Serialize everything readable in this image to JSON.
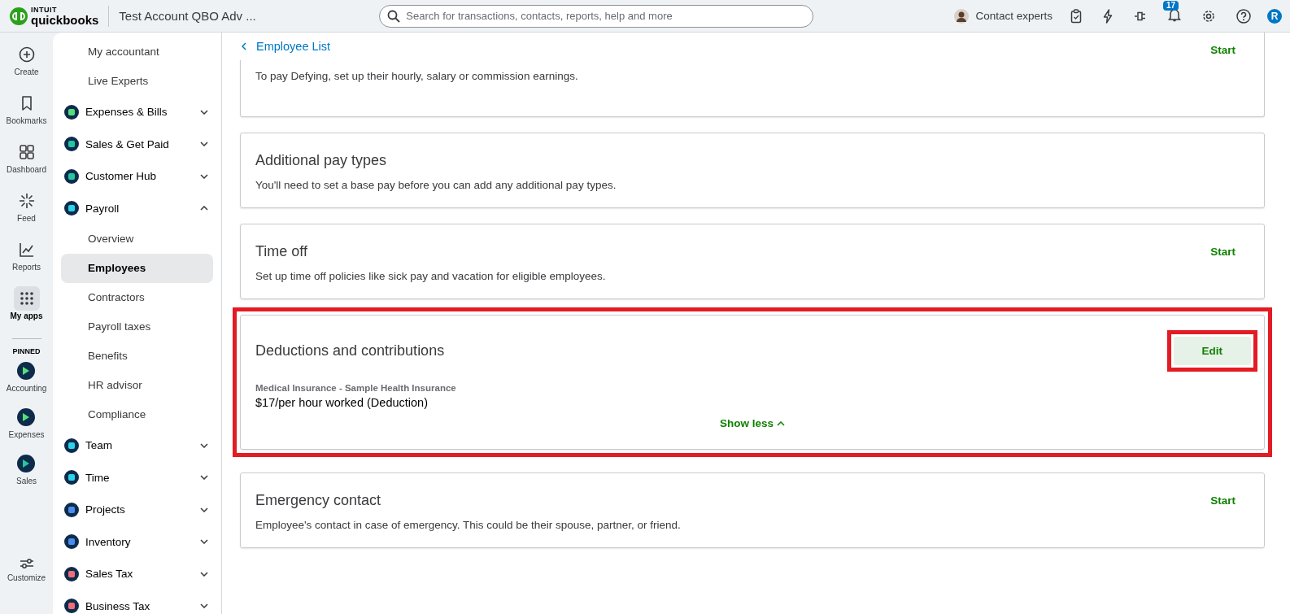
{
  "topbar": {
    "logo_brand": "INTUIT",
    "logo_product": "quickbooks",
    "company": "Test Account QBO Adv ...",
    "search": {
      "placeholder": "Search for transactions, contacts, reports, help and more"
    },
    "contact": "Contact experts",
    "notifications_badge": "17",
    "user_initial": "R"
  },
  "rail": {
    "items": [
      {
        "kind": "create",
        "label": "Create",
        "selected": false
      },
      {
        "kind": "bookmark",
        "label": "Bookmarks",
        "selected": false
      },
      {
        "kind": "dashboard",
        "label": "Dashboard",
        "selected": false
      },
      {
        "kind": "feed",
        "label": "Feed",
        "selected": false
      },
      {
        "kind": "reports",
        "label": "Reports",
        "selected": false
      },
      {
        "kind": "apps",
        "label": "My apps",
        "selected": true
      }
    ],
    "pinned_label": "PINNED",
    "pinned": [
      {
        "label": "Accounting",
        "color": "#53e07a"
      },
      {
        "label": "Expenses",
        "color": "#53e07a"
      },
      {
        "label": "Sales",
        "color": "#21c8a0"
      }
    ],
    "customize": "Customize"
  },
  "nav": {
    "items": [
      {
        "label": "My accountant",
        "kind": "link"
      },
      {
        "label": "Live Experts",
        "kind": "link"
      },
      {
        "label": "Expenses & Bills",
        "kind": "app",
        "color": "#53e07a",
        "expanded": false
      },
      {
        "label": "Sales & Get Paid",
        "kind": "app",
        "color": "#21c8a0",
        "expanded": false
      },
      {
        "label": "Customer Hub",
        "kind": "app",
        "color": "#21c8a0",
        "expanded": false
      },
      {
        "label": "Payroll",
        "kind": "app",
        "color": "#2ad4ea",
        "expanded": true,
        "children": [
          {
            "label": "Overview",
            "selected": false
          },
          {
            "label": "Employees",
            "selected": true
          },
          {
            "label": "Contractors",
            "selected": false
          },
          {
            "label": "Payroll taxes",
            "selected": false
          },
          {
            "label": "Benefits",
            "selected": false
          },
          {
            "label": "HR advisor",
            "selected": false
          },
          {
            "label": "Compliance",
            "selected": false
          }
        ]
      },
      {
        "label": "Team",
        "kind": "app",
        "color": "#2ad4ea",
        "expanded": false
      },
      {
        "label": "Time",
        "kind": "app",
        "color": "#2ad4ea",
        "expanded": false
      },
      {
        "label": "Projects",
        "kind": "app",
        "color": "#4a8cf0",
        "expanded": false
      },
      {
        "label": "Inventory",
        "kind": "app",
        "color": "#4a8cf0",
        "expanded": false
      },
      {
        "label": "Sales Tax",
        "kind": "app",
        "color": "#f26d7a",
        "expanded": false
      },
      {
        "label": "Business Tax",
        "kind": "app",
        "color": "#f26d7a",
        "expanded": false
      }
    ]
  },
  "main": {
    "back_link": "Employee List",
    "cards": [
      {
        "kind": "partial",
        "description": "To pay Defying, set up their hourly, salary or commission earnings.",
        "action": "Start",
        "highlighted": false
      },
      {
        "kind": "info",
        "title": "Additional pay types",
        "description": "You'll need to set a base pay before you can add any additional pay types.",
        "highlighted": false
      },
      {
        "kind": "action",
        "title": "Time off",
        "description": "Set up time off policies like sick pay and vacation for eligible employees.",
        "action": "Start",
        "highlighted": false
      },
      {
        "kind": "detail",
        "title": "Deductions and contributions",
        "action": "Edit",
        "highlighted": true,
        "item_name": "Medical Insurance - Sample Health Insurance",
        "item_amount": "$17/per hour worked (Deduction)",
        "toggle": "Show less"
      },
      {
        "kind": "action",
        "title": "Emergency contact",
        "description": "Employee's contact in case of emergency. This could be their spouse, partner, or friend.",
        "action": "Start",
        "highlighted": false
      }
    ]
  }
}
